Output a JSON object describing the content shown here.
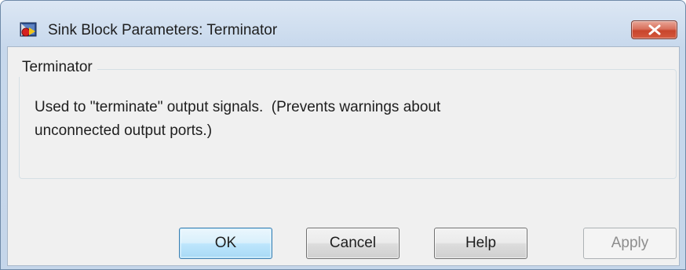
{
  "window": {
    "title": "Sink Block Parameters: Terminator",
    "app_icon": "simulink-block-icon",
    "close_icon": "close-icon"
  },
  "group": {
    "legend": "Terminator",
    "description_lines": [
      "Used to \"terminate\" output signals.  (Prevents warnings about",
      "unconnected output ports.)"
    ]
  },
  "buttons": {
    "ok": "OK",
    "cancel": "Cancel",
    "help": "Help",
    "apply": "Apply"
  },
  "state": {
    "apply_enabled": false,
    "default_button": "OK"
  },
  "colors": {
    "close_button": "#c8452c",
    "default_button_border": "#3c7fb1",
    "disabled_text": "#8d8d8d"
  }
}
